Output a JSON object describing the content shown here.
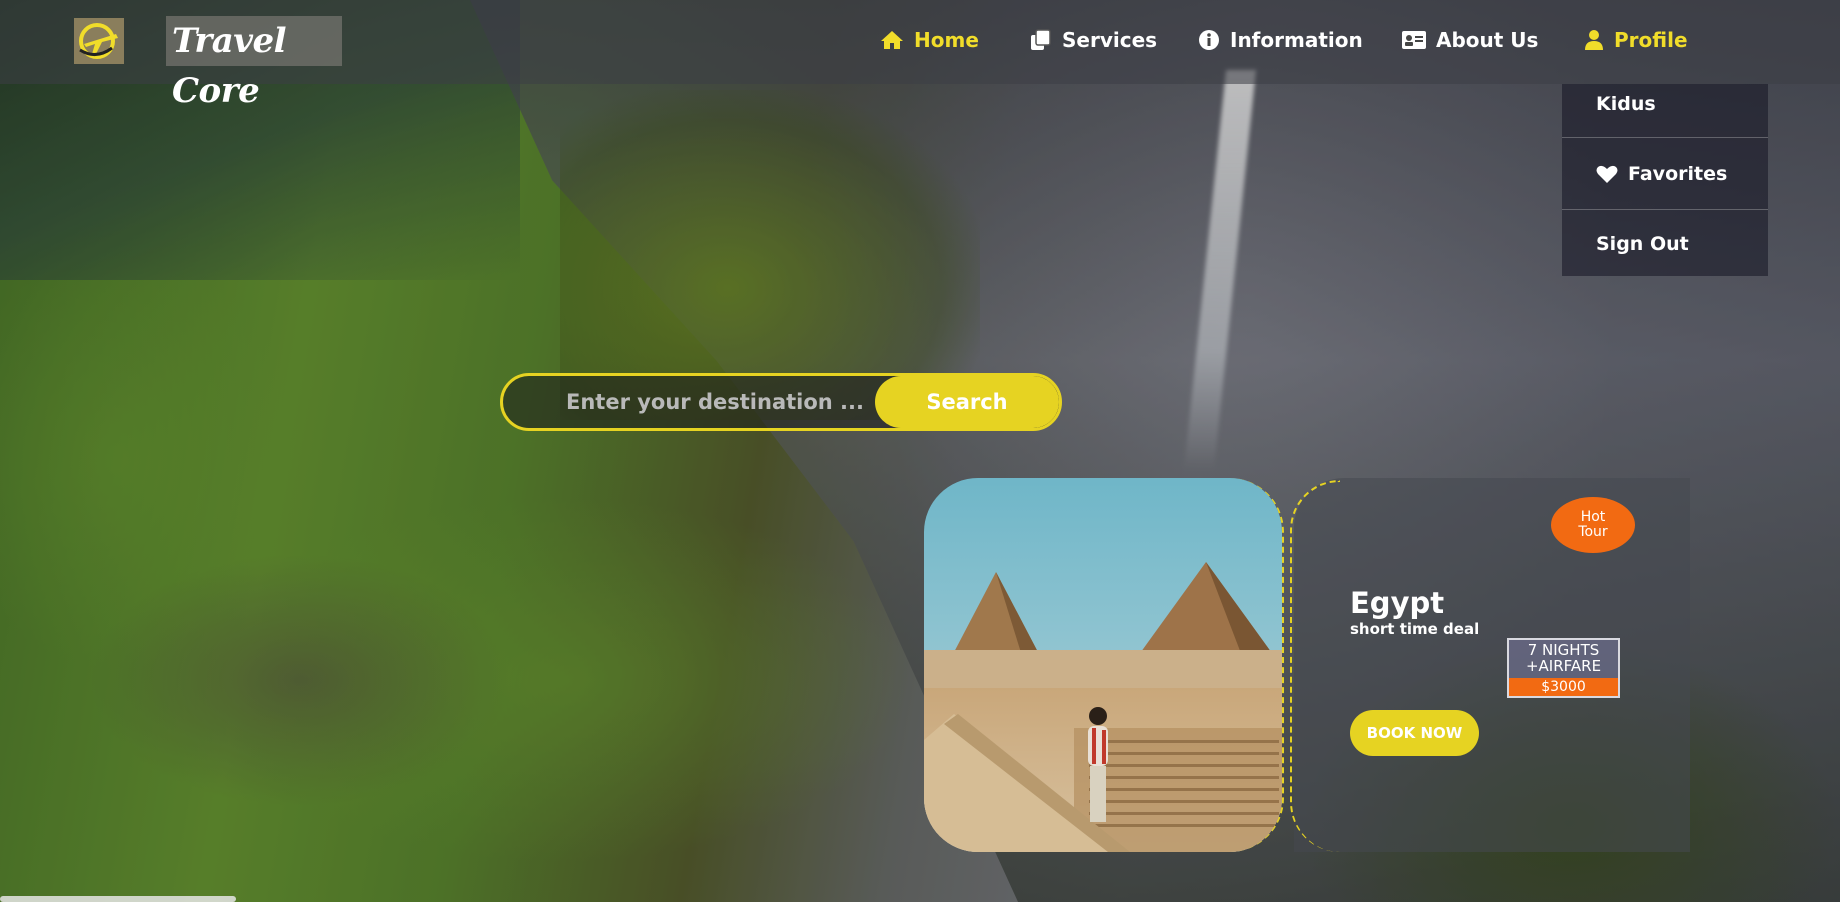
{
  "brand": {
    "name": "Travel Core",
    "logo_icon": "plane-globe-icon"
  },
  "nav": {
    "items": [
      {
        "label": "Home",
        "icon": "home-icon",
        "active": true
      },
      {
        "label": "Services",
        "icon": "copy-icon",
        "active": false
      },
      {
        "label": "Information",
        "icon": "info-circle-icon",
        "active": false
      },
      {
        "label": "About Us",
        "icon": "id-card-icon",
        "active": false
      },
      {
        "label": "Profile",
        "icon": "user-icon",
        "active": true
      }
    ]
  },
  "profile_menu": {
    "username": "Kidus",
    "favorites": "Favorites",
    "sign_out": "Sign Out"
  },
  "search": {
    "placeholder": "Enter your destination ...",
    "button": "Search"
  },
  "tour": {
    "badge_line1": "Hot",
    "badge_line2": "Tour",
    "title": "Egypt",
    "subtitle": "short time deal",
    "package_line1": "7 NIGHTS",
    "package_line2": "+AIRFARE",
    "price": "$3000",
    "book_button": "BOOK NOW"
  },
  "colors": {
    "accent": "#e6d322",
    "badge": "#f26a12",
    "active_nav": "#f1dd2a"
  }
}
